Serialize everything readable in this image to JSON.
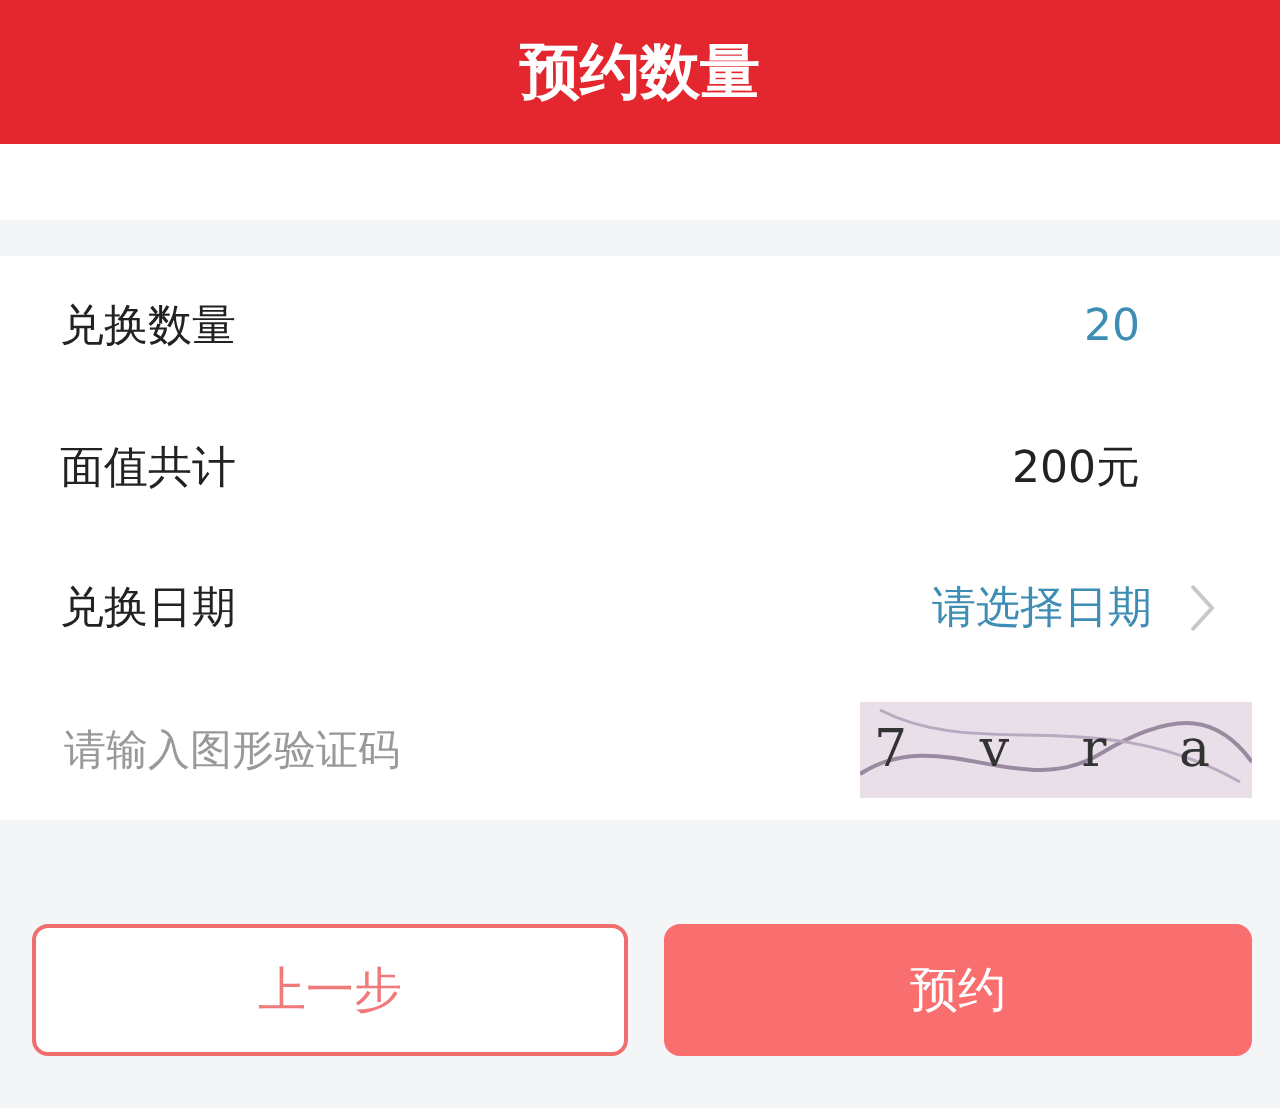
{
  "header": {
    "title": "预约数量"
  },
  "rows": [
    {
      "kind": "value",
      "label": "兑换数量",
      "value": "20",
      "accent": true
    },
    {
      "kind": "value",
      "label": "面值共计",
      "value": "200元",
      "accent": false
    },
    {
      "kind": "select",
      "label": "兑换日期",
      "value": "请选择日期"
    },
    {
      "kind": "captcha",
      "placeholder": "请输入图形验证码",
      "captcha": "7 v r a"
    }
  ],
  "buttons": [
    {
      "label": "上一步",
      "primary": false
    },
    {
      "label": "预约",
      "primary": true
    }
  ]
}
